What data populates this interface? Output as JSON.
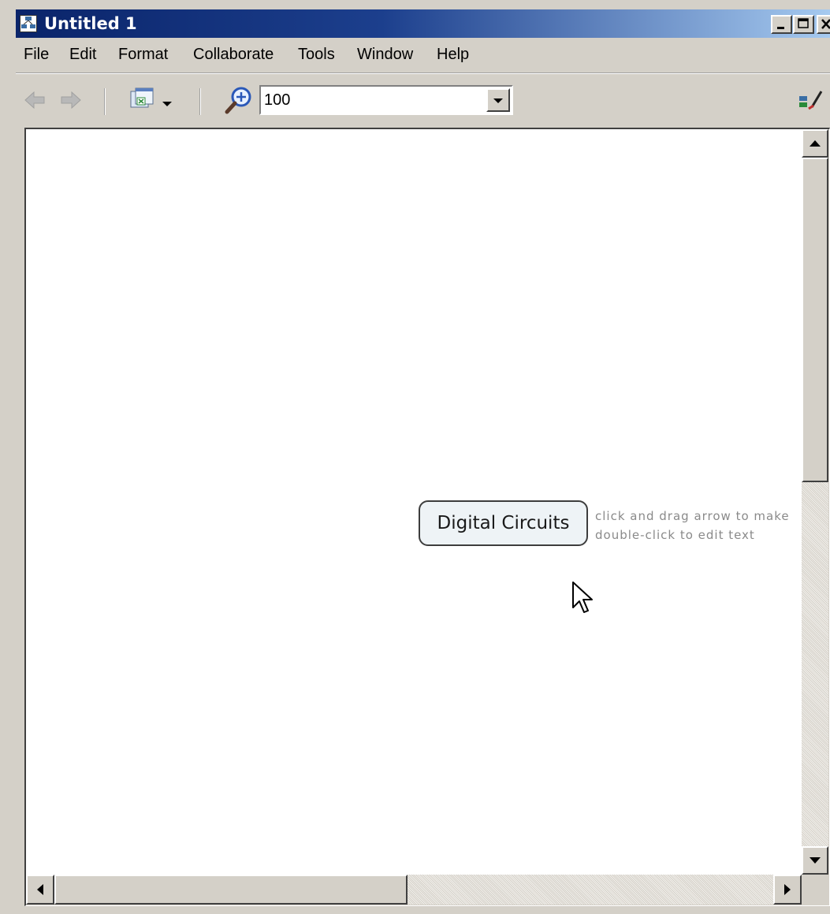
{
  "window": {
    "title": "Untitled 1"
  },
  "menu": [
    "File",
    "Edit",
    "Format",
    "Collaborate",
    "Tools",
    "Window",
    "Help"
  ],
  "toolbar": {
    "zoom_value": "100"
  },
  "canvas": {
    "concept_label": "Digital Circuits",
    "hint_line1": "click and drag arrow to make",
    "hint_line2": "double-click to edit text"
  },
  "icons": [
    "concept-map-app-icon",
    "back-arrow-icon",
    "forward-arrow-icon",
    "view-window-icon",
    "chevron-down-icon",
    "zoom-icon",
    "style-palette-icon",
    "mouse-cursor-icon"
  ],
  "colors": {
    "titlebar_start": "#0a246a",
    "titlebar_end": "#a6caf0",
    "node_fill": "#eef3f6"
  }
}
